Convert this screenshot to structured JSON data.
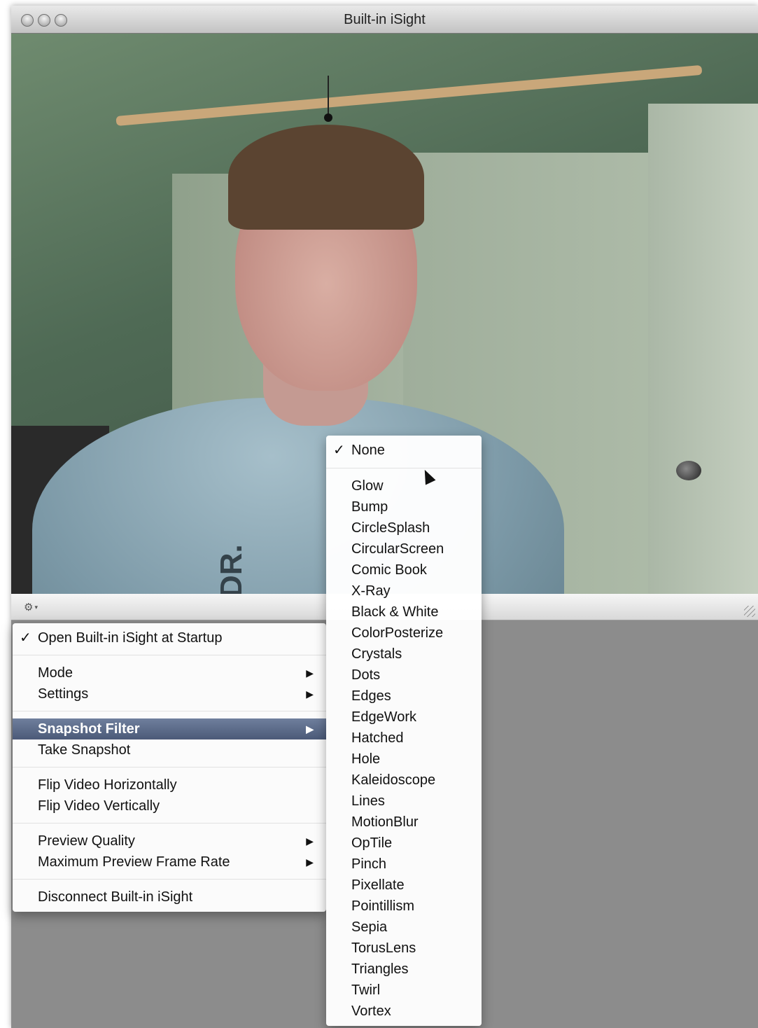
{
  "window": {
    "title": "Built-in iSight"
  },
  "video": {
    "shirt_text": "DR."
  },
  "toolbar": {
    "gear_icon": "gear-icon",
    "gear_glyph": "⚙",
    "chevron_glyph": "▾"
  },
  "main_menu": {
    "check_glyph": "✓",
    "arrow_glyph": "▶",
    "items": [
      {
        "label": "Open Built-in iSight at Startup",
        "checked": true
      },
      {
        "label": "Mode",
        "submenu": true
      },
      {
        "label": "Settings",
        "submenu": true
      },
      {
        "label": "Snapshot Filter",
        "submenu": true,
        "highlighted": true
      },
      {
        "label": "Take Snapshot"
      },
      {
        "label": "Flip Video Horizontally"
      },
      {
        "label": "Flip Video Vertically"
      },
      {
        "label": "Preview Quality",
        "submenu": true
      },
      {
        "label": "Maximum Preview Frame Rate",
        "submenu": true
      },
      {
        "label": "Disconnect Built-in iSight"
      }
    ]
  },
  "filter_menu": {
    "check_glyph": "✓",
    "items": [
      {
        "label": "None",
        "checked": true
      },
      {
        "label": "Glow"
      },
      {
        "label": "Bump"
      },
      {
        "label": "CircleSplash"
      },
      {
        "label": "CircularScreen"
      },
      {
        "label": "Comic Book"
      },
      {
        "label": "X-Ray"
      },
      {
        "label": "Black & White"
      },
      {
        "label": "ColorPosterize"
      },
      {
        "label": "Crystals"
      },
      {
        "label": "Dots"
      },
      {
        "label": "Edges"
      },
      {
        "label": "EdgeWork"
      },
      {
        "label": "Hatched"
      },
      {
        "label": "Hole"
      },
      {
        "label": "Kaleidoscope"
      },
      {
        "label": "Lines"
      },
      {
        "label": "MotionBlur"
      },
      {
        "label": "OpTile"
      },
      {
        "label": "Pinch"
      },
      {
        "label": "Pixellate"
      },
      {
        "label": "Pointillism"
      },
      {
        "label": "Sepia"
      },
      {
        "label": "TorusLens"
      },
      {
        "label": "Triangles"
      },
      {
        "label": "Twirl"
      },
      {
        "label": "Vortex"
      }
    ]
  }
}
